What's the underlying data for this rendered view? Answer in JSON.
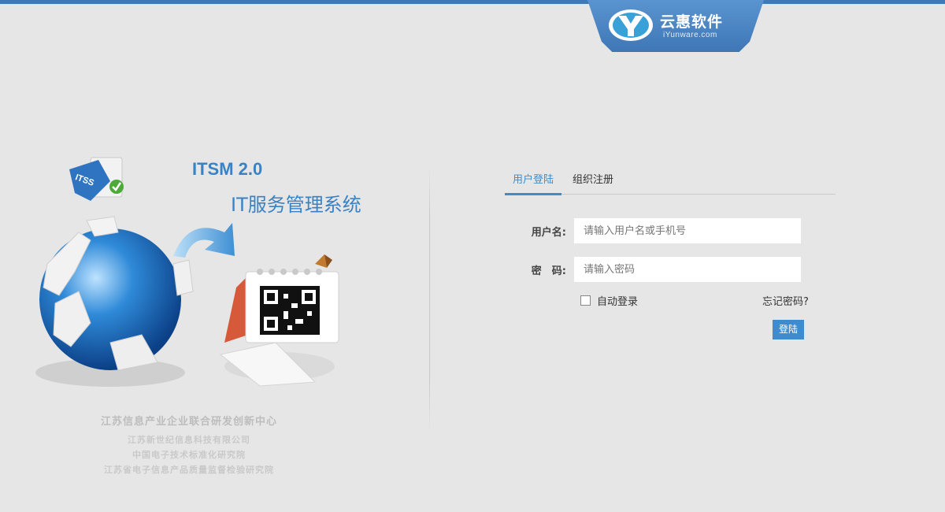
{
  "brand": {
    "name": "云惠软件",
    "url": "iYunware.com"
  },
  "hero": {
    "title": "ITSM 2.0",
    "subtitle": "IT服务管理系统",
    "badge_text": "ITSS"
  },
  "organizations": {
    "main": "江苏信息产业企业联合研发创新中心",
    "lines": [
      "江苏新世纪信息科技有限公司",
      "中国电子技术标准化研究院",
      "江苏省电子信息产品质量监督检验研究院"
    ]
  },
  "tabs": [
    {
      "label": "用户登陆",
      "active": true
    },
    {
      "label": "组织注册",
      "active": false
    }
  ],
  "form": {
    "username_label": "用户名:",
    "username_placeholder": "请输入用户名或手机号",
    "password_label": "密　码:",
    "password_placeholder": "请输入密码",
    "remember_label": "自动登录",
    "forgot_label": "忘记密码?",
    "login_label": "登陆"
  },
  "colors": {
    "accent": "#3c8dcc",
    "background": "#e6e6e6",
    "brand_bar": "#3f79b8"
  }
}
